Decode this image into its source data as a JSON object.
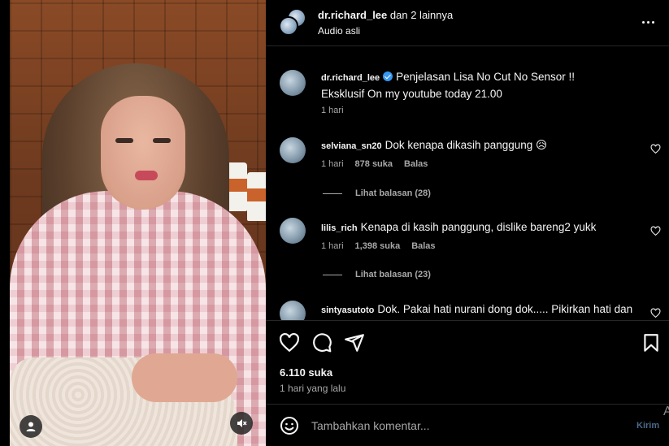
{
  "header": {
    "username": "dr.richard_lee",
    "collab_text": "dan 2 lainnya",
    "audio_label": "Audio asli"
  },
  "caption": {
    "username": "dr.richard_lee",
    "verified": true,
    "text_line1": "Penjelasan Lisa No Cut No Sensor !!",
    "text_line2": "Eksklusif On my youtube today 21.00",
    "time": "1 hari"
  },
  "comments": [
    {
      "username": "selviana_sn20",
      "text": "Dok kenapa dikasih panggung 😥",
      "time": "1 hari",
      "likes": "878 suka",
      "reply_label": "Balas",
      "view_replies": "Lihat balasan (28)"
    },
    {
      "username": "lilis_rich",
      "text": "Kenapa di kasih panggung, dislike bareng2 yukk",
      "time": "1 hari",
      "likes": "1,398 suka",
      "reply_label": "Balas",
      "view_replies": "Lihat balasan (23)"
    },
    {
      "username": "sintyasutoto",
      "text": "Dok. Pakai hati nurani dong dok..... Pikirkan hati dan"
    }
  ],
  "stats": {
    "likes": "6.110 suka",
    "posted": "1 hari yang lalu"
  },
  "composer": {
    "placeholder": "Tambahkan komentar...",
    "post_label": "Kirim"
  },
  "edge_char": "A",
  "icons": {
    "like": "heart-icon",
    "comment": "comment-icon",
    "share": "send-icon",
    "save": "bookmark-icon",
    "more": "more-icon",
    "emoji": "emoji-icon",
    "profile": "user-icon",
    "mute": "muted-speaker-icon"
  },
  "colors": {
    "background": "#000000",
    "text": "#f5f5f5",
    "muted": "#a8a8a8",
    "divider": "#262626",
    "verified": "#3897f0",
    "post_disabled": "#4a6a8a"
  }
}
